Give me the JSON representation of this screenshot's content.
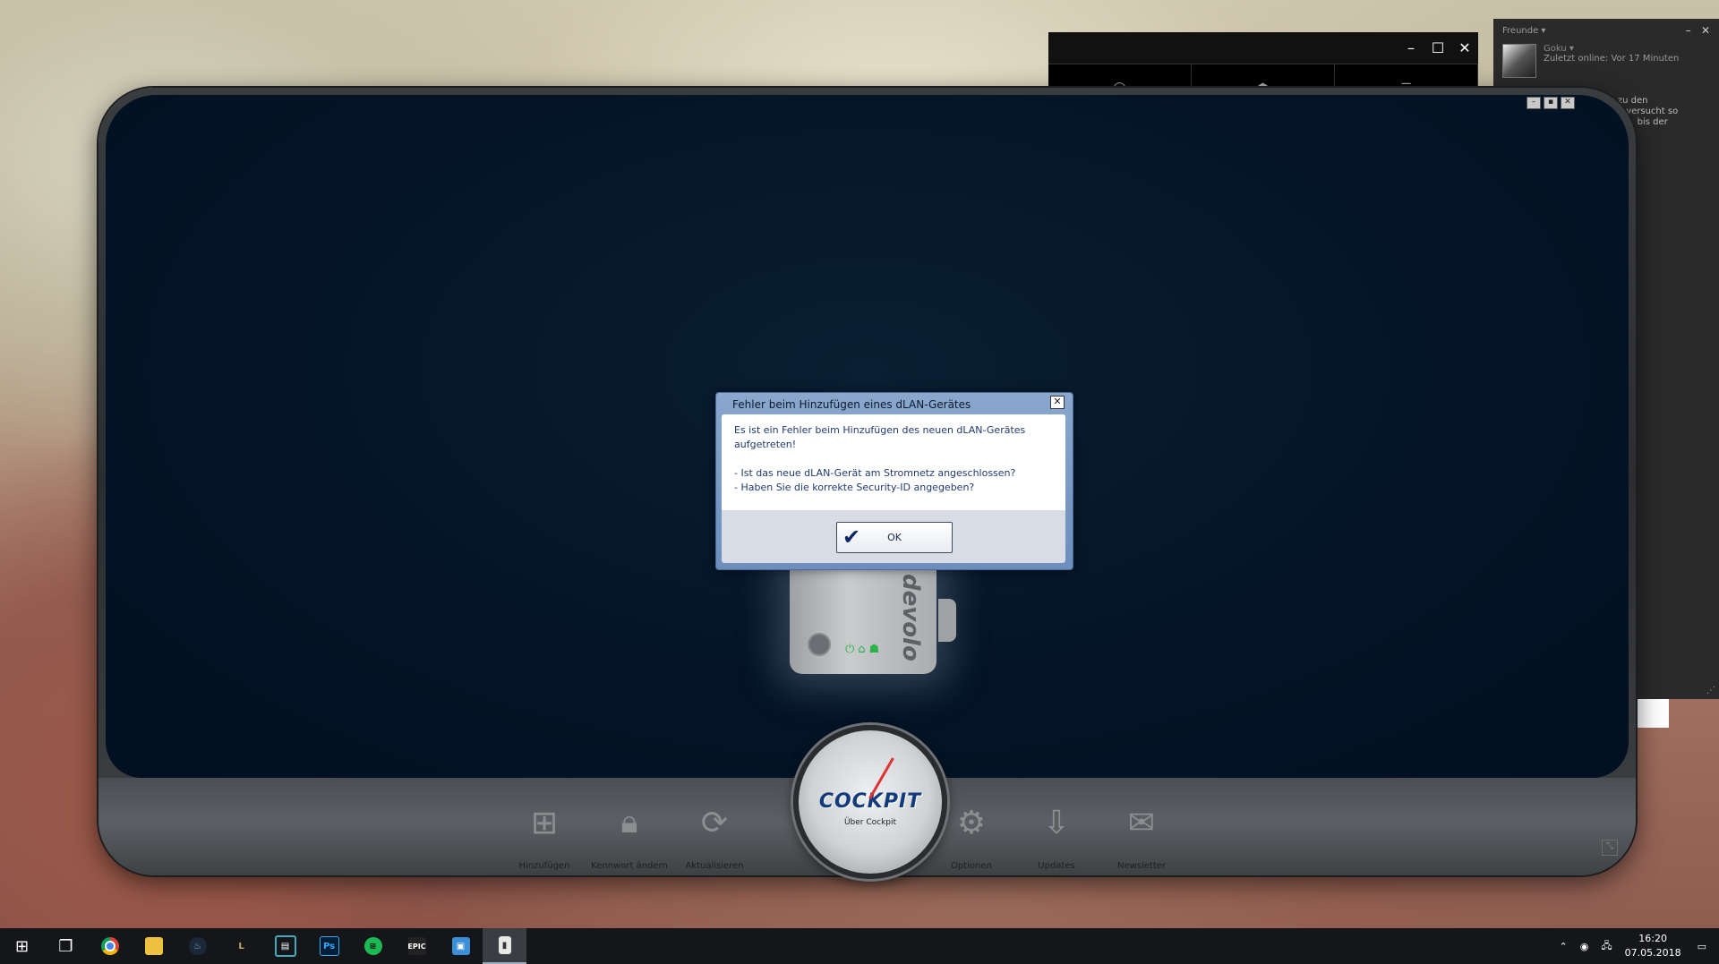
{
  "media_window": {
    "controls": [
      "–",
      "☐",
      "✕"
    ]
  },
  "friends_panel": {
    "title": "Freunde",
    "friend_name": "Goku",
    "friend_status": "Zuletzt online: Vor 17 Minuten",
    "message_lines": [
      "ng zu den",
      "eam versucht so",
      "bauen, bis der"
    ]
  },
  "cockpit": {
    "window_controls": [
      "–",
      "▪",
      "✕"
    ],
    "device_brand": "devolo",
    "gauge_logo": "COCKPIT",
    "gauge_label": "Über Cockpit",
    "toolbar": {
      "add": "Hinzufügen",
      "password": "Kennwort ändern",
      "refresh": "Aktualisieren",
      "options": "Optionen",
      "updates": "Updates",
      "newsletter": "Newsletter"
    }
  },
  "dialog": {
    "title": "Fehler beim Hinzufügen eines dLAN-Gerätes",
    "close": "✕",
    "message": [
      "Es ist ein Fehler beim Hinzufügen des neuen dLAN-Gerätes",
      "aufgetreten!",
      "",
      "- Ist das neue dLAN-Gerät am Stromnetz angeschlossen?",
      "- Haben Sie die korrekte Security-ID angegeben?"
    ],
    "ok_label": "OK"
  },
  "taskbar": {
    "time": "16:20",
    "date": "07.05.2018",
    "apps": [
      "windows-start",
      "task-view",
      "chrome",
      "file-explorer",
      "steam",
      "league-of-legends",
      "video-editor",
      "photoshop",
      "spotify",
      "epic-games",
      "remote-desktop",
      "cockpit"
    ],
    "ps_label": "Ps",
    "epic_label": "EPIC"
  },
  "colors": {
    "accent": "#6d8ebd",
    "screen": "#041426",
    "led": "#2ab34a"
  }
}
